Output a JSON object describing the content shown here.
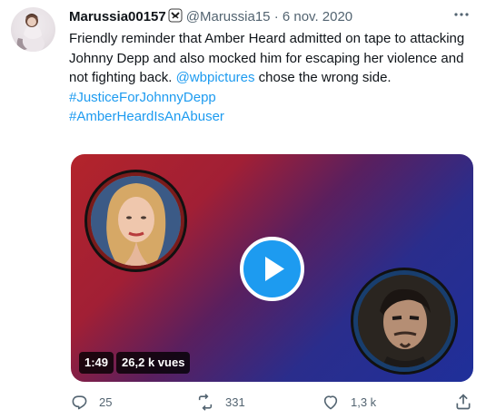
{
  "tweet": {
    "display_name": "Marussia00157",
    "handle": "@Marussia15",
    "separator": "·",
    "date": "6 nov. 2020",
    "text_before_mention": "Friendly reminder that Amber Heard admitted on tape to attacking Johnny Depp and also mocked him for escaping her violence and not fighting back. ",
    "mention": "@wbpictures",
    "text_after_mention": " chose the wrong side.",
    "hashtags": [
      "#JusticeForJohnnyDepp",
      "#AmberHeardIsAnAbuser"
    ],
    "video": {
      "duration": "1:49",
      "views": "26,2 k vues"
    },
    "actions": {
      "replies": "25",
      "retweets": "331",
      "likes": "1,3 k"
    }
  },
  "colors": {
    "link": "#1d9bf0",
    "muted": "#536471",
    "text": "#0f1419"
  },
  "icons": [
    "more-icon",
    "verified-style-badge-icon",
    "play-icon",
    "reply-icon",
    "retweet-icon",
    "like-icon",
    "share-icon"
  ]
}
